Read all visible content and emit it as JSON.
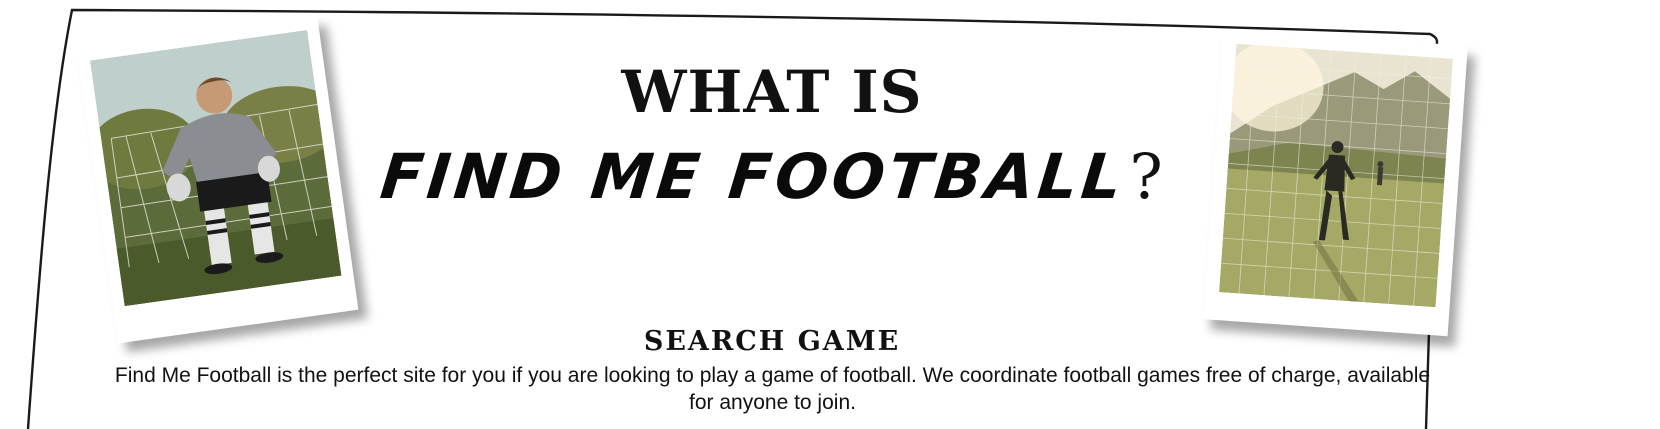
{
  "hero": {
    "title_line_1": "WHAT IS",
    "brand_name": "FIND ME FOOTBALL",
    "question_mark": "?"
  },
  "section": {
    "heading": "SEARCH GAME",
    "body": "Find Me Football is the perfect site for you if you are looking to play a game of football. We coordinate football games free of charge, available for anyone to join."
  },
  "colors": {
    "text": "#111111",
    "frame_stroke": "#1a1a1a",
    "background": "#ffffff"
  }
}
